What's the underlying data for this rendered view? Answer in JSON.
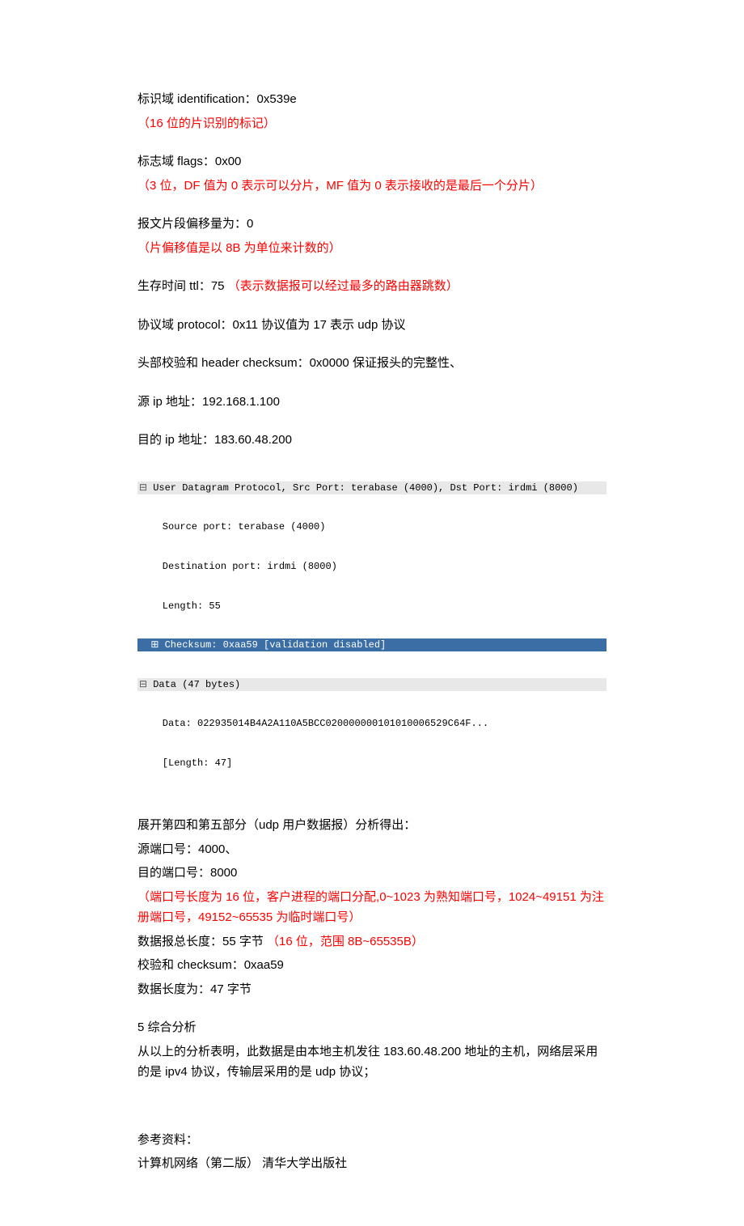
{
  "ident_line": "标识域 identification：0x539e",
  "ident_note": "（16 位的片识别的标记）",
  "flags_line": "标志域 flags：0x00",
  "flags_note": "（3 位，DF 值为 0 表示可以分片，MF 值为 0 表示接收的是最后一个分片）",
  "offset_line": "报文片段偏移量为：0",
  "offset_note": "（片偏移值是以 8B 为单位来计数的）",
  "ttl_prefix": "生存时间 ttl：75  ",
  "ttl_note": "（表示数据报可以经过最多的路由器跳数）",
  "protocol_line": "协议域 protocol：0x11  协议值为 17 表示 udp 协议",
  "checksum_line": "头部校验和 header checksum：0x0000  保证报头的完整性、",
  "src_ip_line": "源 ip 地址：192.168.1.100",
  "dst_ip_line": "目的 ip 地址：183.60.48.200",
  "packet": {
    "udp_header": "User Datagram Protocol, Src Port: terabase (4000), Dst Port: irdmi (8000)",
    "src_port": "    Source port: terabase (4000)",
    "dst_port": "    Destination port: irdmi (8000)",
    "length": "    Length: 55",
    "checksum": "Checksum: 0xaa59 [validation disabled]",
    "data_header": "Data (47 bytes)",
    "data_line": "    Data: 022935014B4A2A110A5BCC020000000101010006529C64F...",
    "data_len": "    [Length: 47]"
  },
  "analysis_intro": "展开第四和第五部分（udp 用户数据报）分析得出：",
  "src_port_text": "源端口号：4000、",
  "dst_port_text": "目的端口号：8000",
  "port_note": "（端口号长度为 16 位，客户进程的端口分配,0~1023 为熟知端口号，1024~49151 为注册端口号，49152~65535 为临时端口号）",
  "len_prefix": "数据报总长度：55 字节  ",
  "len_note": "（16 位，范围 8B~65535B）",
  "chk_text": "校验和 checksum：0xaa59",
  "data_len_text": "数据长度为：47 字节",
  "section5_title": "5 综合分析",
  "section5_body": "从以上的分析表明，此数据是由本地主机发往 183.60.48.200 地址的主机，网络层采用的是 ipv4 协议，传输层采用的是 udp 协议；",
  "refs_title": "参考资料：",
  "refs_body": "计算机网络（第二版）  清华大学出版社"
}
